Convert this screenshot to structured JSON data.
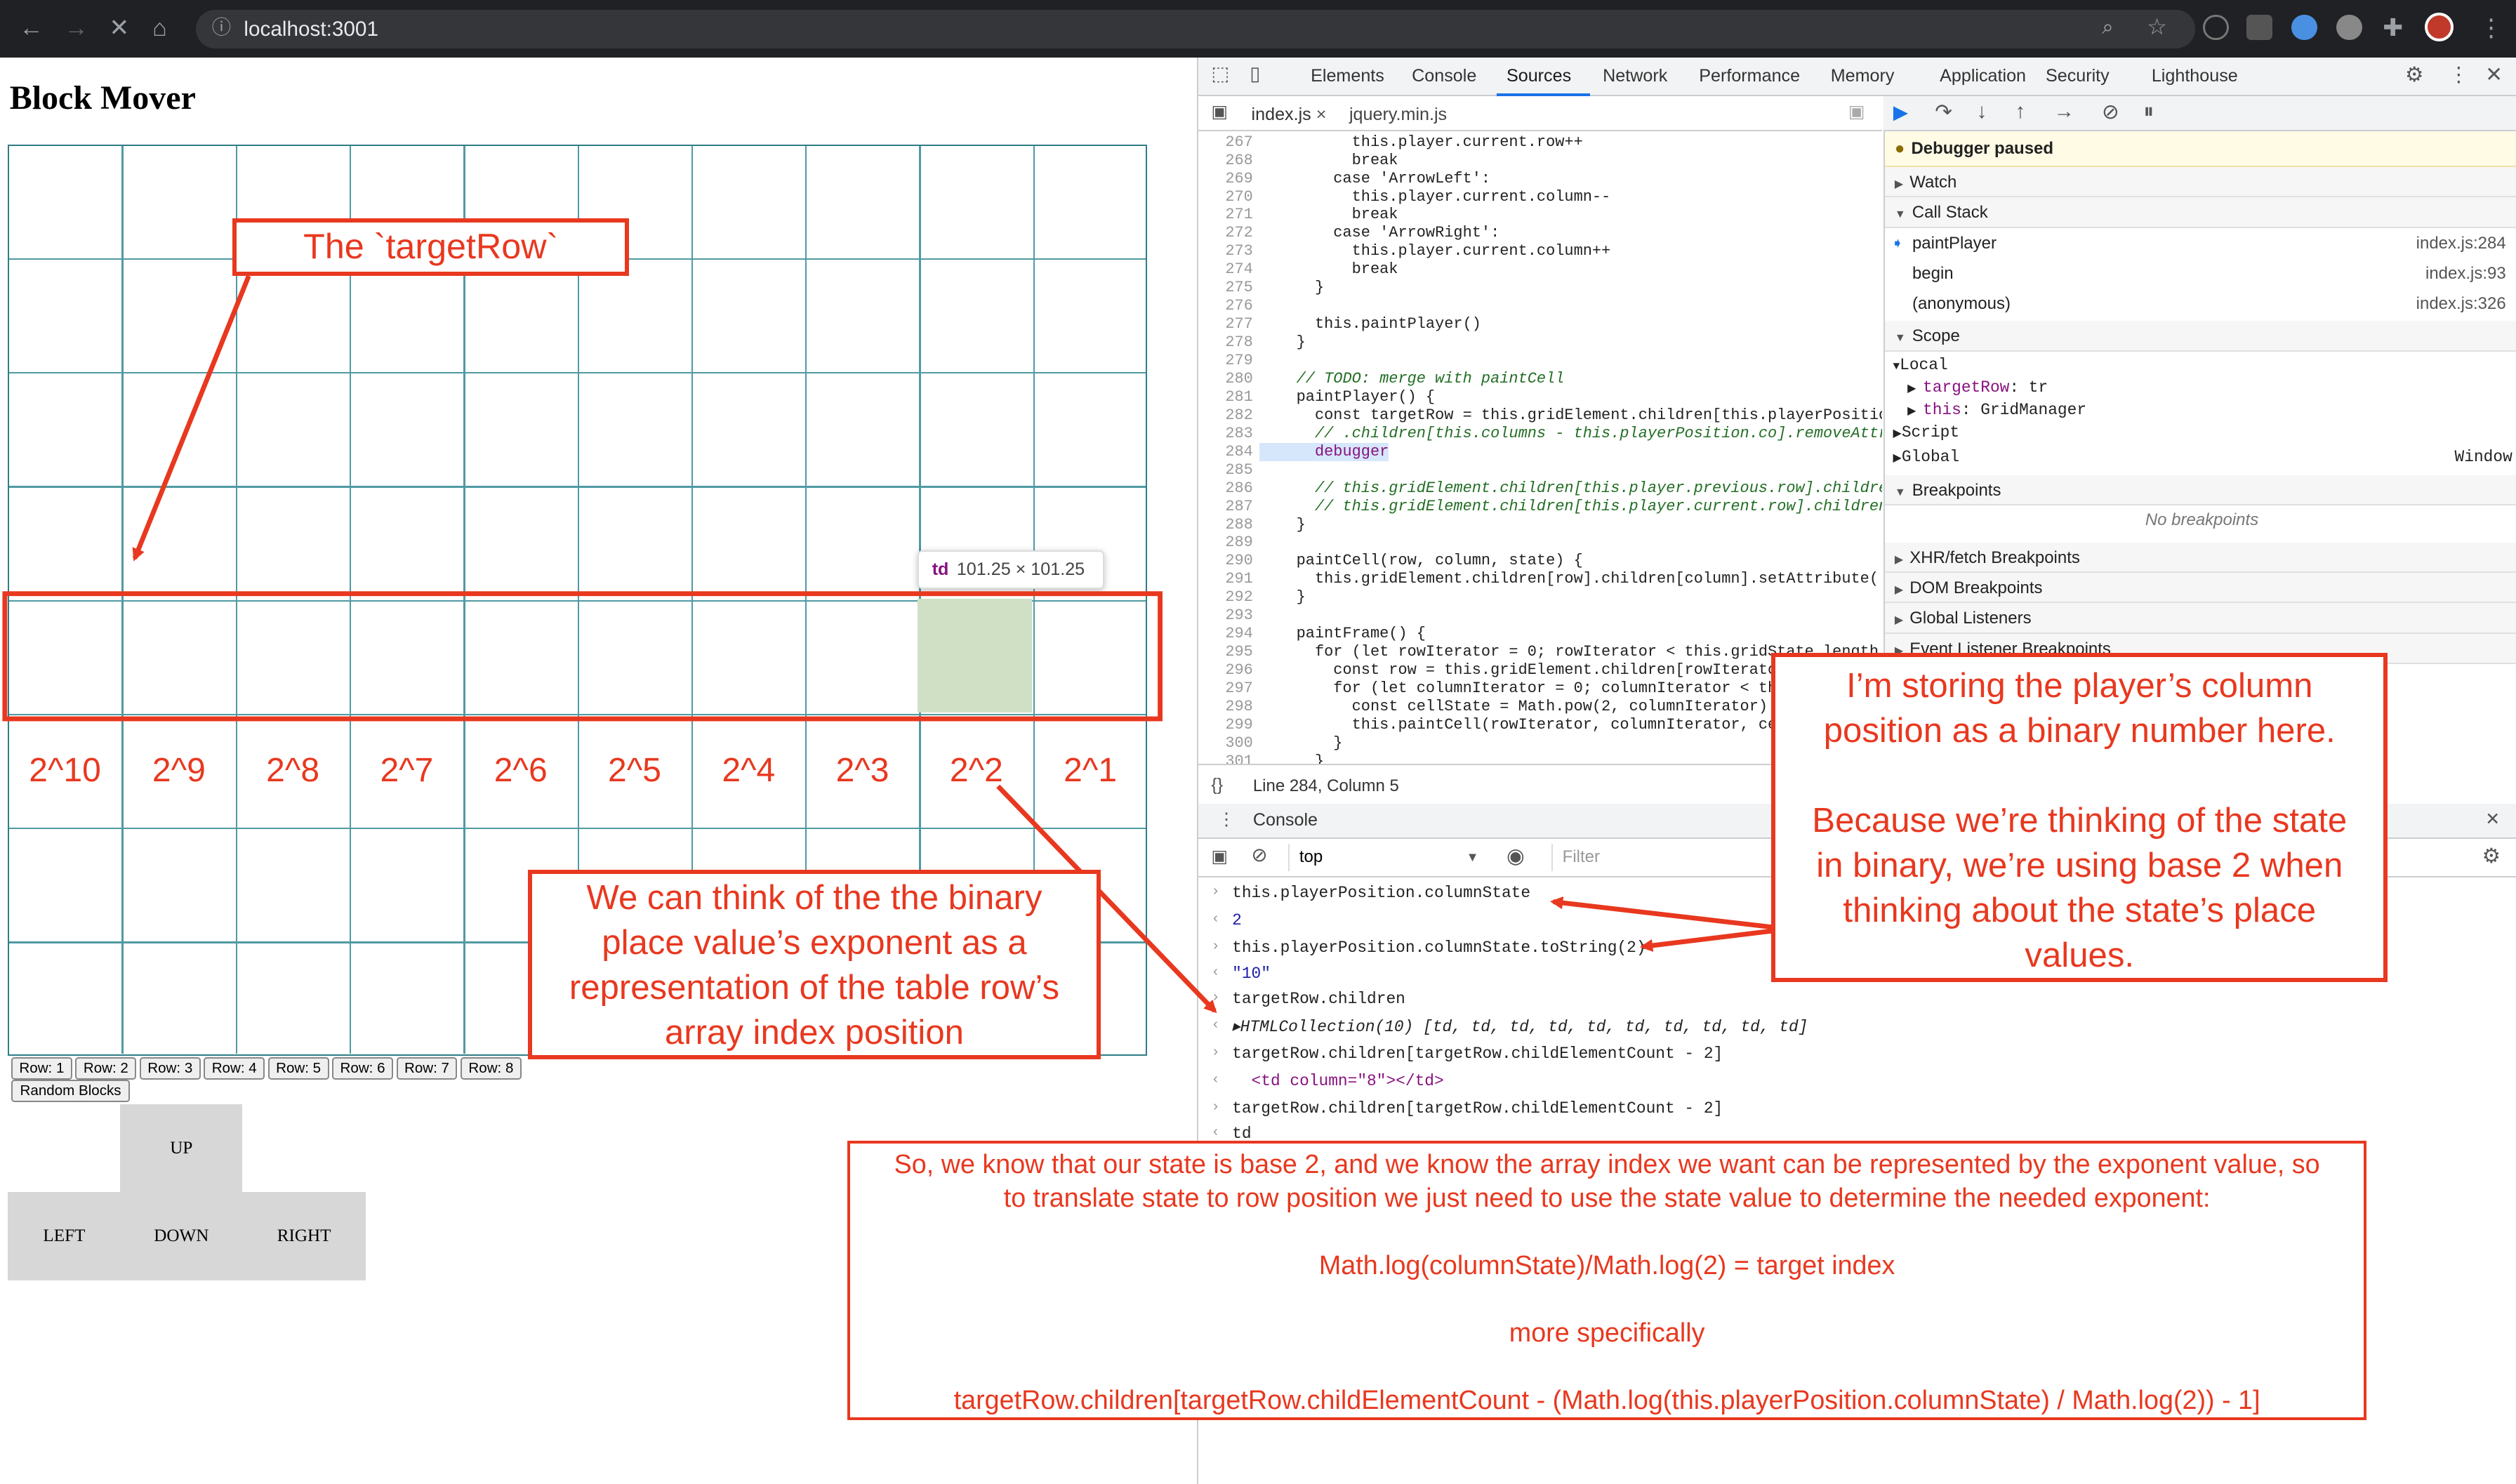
{
  "browser": {
    "url": "localhost:3001"
  },
  "page": {
    "title": "Block Mover",
    "powers": [
      "2^10",
      "2^9",
      "2^8",
      "2^7",
      "2^6",
      "2^5",
      "2^4",
      "2^3",
      "2^2",
      "2^1"
    ],
    "tooltip": {
      "tag": "td",
      "size": "101.25 × 101.25"
    },
    "row_buttons": [
      "Row: 1",
      "Row: 2",
      "Row: 3",
      "Row: 4",
      "Row: 5",
      "Row: 6",
      "Row: 7",
      "Row: 8"
    ],
    "random_button": "Random Blocks",
    "controls": {
      "up": "UP",
      "left": "LEFT",
      "down": "DOWN",
      "right": "RIGHT"
    }
  },
  "devtools": {
    "tabs": [
      "Elements",
      "Console",
      "Sources",
      "Network",
      "Performance",
      "Memory",
      "Application",
      "Security",
      "Lighthouse"
    ],
    "files": [
      "index.js",
      "jquery.min.js"
    ],
    "code": [
      [
        "267",
        "          this.player.current.row++"
      ],
      [
        "268",
        "          break"
      ],
      [
        "269",
        "        case 'ArrowLeft':"
      ],
      [
        "270",
        "          this.player.current.column--"
      ],
      [
        "271",
        "          break"
      ],
      [
        "272",
        "        case 'ArrowRight':"
      ],
      [
        "273",
        "          this.player.current.column++"
      ],
      [
        "274",
        "          break"
      ],
      [
        "275",
        "      }"
      ],
      [
        "276",
        ""
      ],
      [
        "277",
        "      this.paintPlayer()"
      ],
      [
        "278",
        "    }"
      ],
      [
        "279",
        ""
      ],
      [
        "280",
        "    // TODO: merge with paintCell"
      ],
      [
        "281",
        "    paintPlayer() {"
      ],
      [
        "282",
        "      const targetRow = this.gridElement.children[this.playerPosition"
      ],
      [
        "283",
        "      // .children[this.columns - this.playerPosition.co].removeAttri"
      ],
      [
        "284",
        "      debugger"
      ],
      [
        "285",
        ""
      ],
      [
        "286",
        "      // this.gridElement.children[this.player.previous.row].children"
      ],
      [
        "287",
        "      // this.gridElement.children[this.player.current.row].children["
      ],
      [
        "288",
        "    }"
      ],
      [
        "289",
        ""
      ],
      [
        "290",
        "    paintCell(row, column, state) {"
      ],
      [
        "291",
        "      this.gridElement.children[row].children[column].setAttribute('p"
      ],
      [
        "292",
        "    }"
      ],
      [
        "293",
        ""
      ],
      [
        "294",
        "    paintFrame() {"
      ],
      [
        "295",
        "      for (let rowIterator = 0; rowIterator < this.gridState.length;"
      ],
      [
        "296",
        "        const row = this.gridElement.children[rowIterator"
      ],
      [
        "297",
        "        for (let columnIterator = 0; columnIterator < thi"
      ],
      [
        "298",
        "          const cellState = Math.pow(2, columnIterator) &"
      ],
      [
        "299",
        "          this.paintCell(rowIterator, columnIterator, ce"
      ],
      [
        "300",
        "        }"
      ],
      [
        "301",
        "      }"
      ]
    ],
    "status": "Line 284, Column 5",
    "debugger_paused": "Debugger paused",
    "watch": "Watch",
    "call_stack": "Call Stack",
    "stack": [
      [
        "paintPlayer",
        "index.js:284"
      ],
      [
        "begin",
        "index.js:93"
      ],
      [
        "(anonymous)",
        "index.js:326"
      ]
    ],
    "scope": "Scope",
    "local": "Local",
    "scope_vars": [
      [
        "targetRow",
        ": tr"
      ],
      [
        "this",
        ": GridManager"
      ]
    ],
    "script": "Script",
    "global": "Global",
    "window": "Window",
    "breakpoints": "Breakpoints",
    "no_breakpoints": "No breakpoints",
    "xhr": "XHR/fetch Breakpoints",
    "dom": "DOM Breakpoints",
    "global_listeners": "Global Listeners",
    "event_listeners": "Event Listener Breakpoints",
    "console_title": "Console",
    "context": "top",
    "filter_placeholder": "Filter",
    "console": [
      [
        "›",
        "this.playerPosition.columnState"
      ],
      [
        "‹",
        "2"
      ],
      [
        "›",
        "this.playerPosition.columnState.toString(2)"
      ],
      [
        "‹",
        "\"10\""
      ],
      [
        "›",
        "targetRow.children"
      ],
      [
        "‹",
        "▸HTMLCollection(10) [td, td, td, td, td, td, td, td, td, td]"
      ],
      [
        "›",
        "targetRow.children[targetRow.childElementCount - 2]"
      ],
      [
        "‹",
        "  <td column=\"8\"></td>"
      ],
      [
        "›",
        "targetRow.children[targetRow.childElementCount - 2]"
      ],
      [
        "‹",
        "td"
      ]
    ]
  },
  "annotations": {
    "target_row": "The `targetRow`",
    "storing": [
      "I’m storing the player’s column",
      "position as a binary number here.",
      "",
      "Because we’re thinking of the state",
      "in binary, we’re using base 2 when",
      "thinking about the state’s place",
      "values."
    ],
    "exponent": [
      "We can think of the the binary",
      "place value’s exponent as a",
      "representation of the table row’s",
      "array index position"
    ],
    "summary": [
      "So, we know that our state is base 2, and we know the array index we want can be represented by the exponent value, so",
      "to translate state to row position we just need to use the state value to determine the needed exponent:",
      "",
      "Math.log(columnState)/Math.log(2) = target index",
      "",
      "more specifically",
      "",
      "targetRow.children[targetRow.childElementCount - (Math.log(this.playerPosition.columnState) / Math.log(2)) - 1]"
    ]
  },
  "colors": {
    "annotation": "#e8381f",
    "grid": "#2f7d86",
    "player": "#cfe0c4"
  }
}
